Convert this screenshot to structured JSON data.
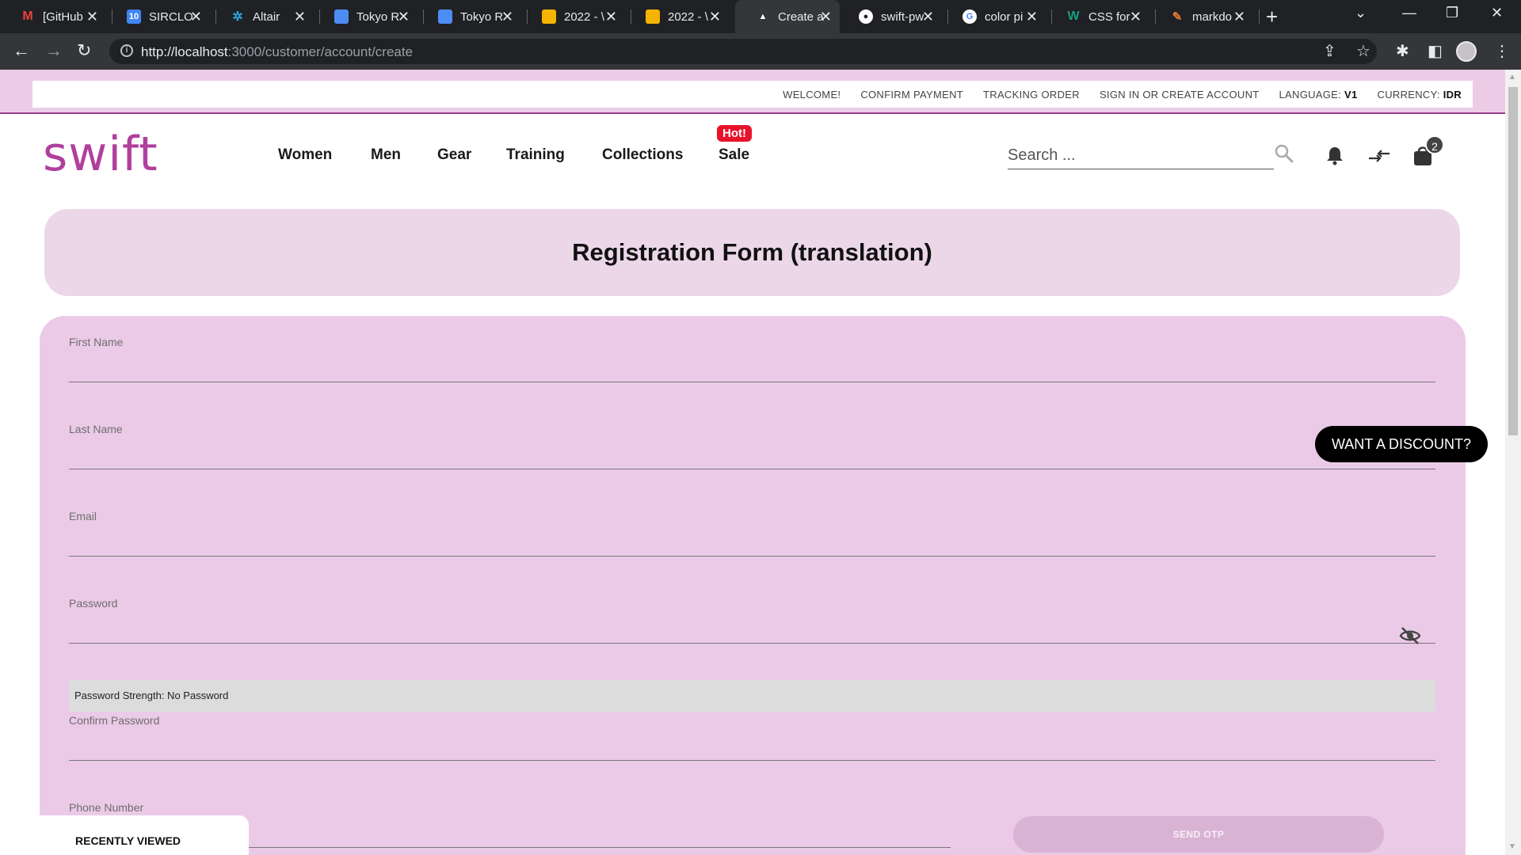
{
  "browser": {
    "tabs": [
      {
        "title": "[GitHub",
        "favicon": "gmail",
        "color": "#ea4335"
      },
      {
        "title": "SIRCLO",
        "favicon": "calendar",
        "color": "#4285f4"
      },
      {
        "title": "Altair",
        "favicon": "altair",
        "color": "#2aa3d8"
      },
      {
        "title": "Tokyo R",
        "favicon": "doc",
        "color": "#4d8cf5"
      },
      {
        "title": "Tokyo R",
        "favicon": "doc",
        "color": "#4d8cf5"
      },
      {
        "title": "2022 - \\",
        "favicon": "slides",
        "color": "#f4b400"
      },
      {
        "title": "2022 - \\",
        "favicon": "slides",
        "color": "#f4b400"
      },
      {
        "title": "Create a",
        "favicon": "vercel",
        "color": "#ffffff"
      },
      {
        "title": "swift-pw",
        "favicon": "github",
        "color": "#ffffff"
      },
      {
        "title": "color pi",
        "favicon": "google",
        "color": "#4285f4"
      },
      {
        "title": "CSS for",
        "favicon": "w",
        "color": "#14a085"
      },
      {
        "title": "markdo",
        "favicon": "markdown",
        "color": "#e37933"
      }
    ],
    "url_host": "http://localhost",
    "url_rest": ":3000/customer/account/create"
  },
  "topbar": {
    "welcome": "WELCOME!",
    "confirm_payment": "CONFIRM PAYMENT",
    "tracking_order": "TRACKING ORDER",
    "sign_in": "SIGN IN OR CREATE ACCOUNT",
    "language_label": "LANGUAGE:",
    "language_value": "V1",
    "currency_label": "CURRENCY:",
    "currency_value": "IDR"
  },
  "header": {
    "logo": "swift",
    "menu": [
      "Women",
      "Men",
      "Gear",
      "Training",
      "Collections",
      "Sale"
    ],
    "hot_badge": "Hot!",
    "search_placeholder": "Search ...",
    "cart_count": "2"
  },
  "form": {
    "title": "Registration Form (translation)",
    "first_name": "First Name",
    "last_name": "Last Name",
    "email": "Email",
    "password": "Password",
    "password_strength": "Password Strength: No Password",
    "confirm_password": "Confirm Password",
    "phone_number": "Phone Number",
    "send_otp": "SEND OTP"
  },
  "widgets": {
    "discount": "WANT A DISCOUNT?",
    "recently_viewed": "RECENTLY VIEWED"
  },
  "colors": {
    "brand": "#b13f9d",
    "title_bg": "#ecd7e9",
    "form_bg": "#ebcae7",
    "hot": "#e8132a"
  }
}
